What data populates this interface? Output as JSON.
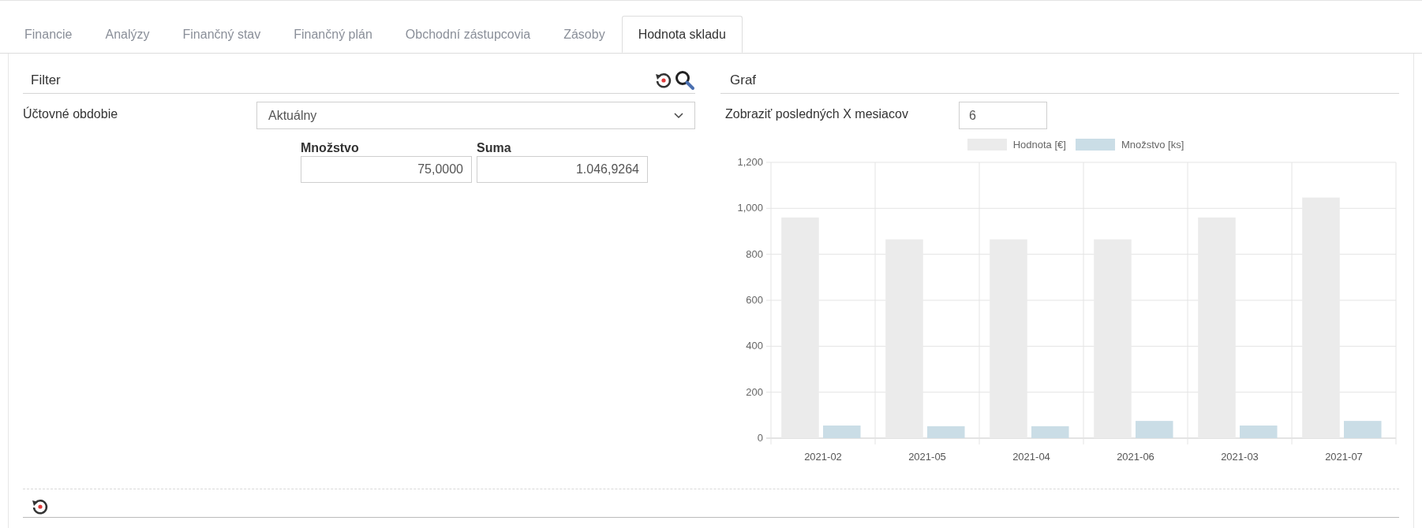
{
  "tabs": [
    {
      "label": "Financie",
      "selected": false
    },
    {
      "label": "Analýzy",
      "selected": false
    },
    {
      "label": "Finančný stav",
      "selected": false
    },
    {
      "label": "Finančný plán",
      "selected": false
    },
    {
      "label": "Obchodní zástupcovia",
      "selected": false
    },
    {
      "label": "Zásoby",
      "selected": false
    },
    {
      "label": "Hodnota skladu",
      "selected": true
    }
  ],
  "filter": {
    "title": "Filter",
    "period_label": "Účtovné obdobie",
    "period_value": "Aktuálny",
    "columns": [
      {
        "label": "Množstvo",
        "value": "75,0000"
      },
      {
        "label": "Suma",
        "value": "1.046,9264"
      }
    ]
  },
  "graph": {
    "title": "Graf",
    "months_label": "Zobraziť posledných X mesiacov",
    "months_value": "6",
    "chart_data": {
      "type": "bar",
      "categories": [
        "2021-02",
        "2021-05",
        "2021-04",
        "2021-06",
        "2021-03",
        "2021-07"
      ],
      "series": [
        {
          "name": "Hodnota [€]",
          "color": "#ebebeb",
          "values": [
            960,
            865,
            865,
            865,
            960,
            1047
          ]
        },
        {
          "name": "Množstvo [ks]",
          "color": "#cadde6",
          "values": [
            55,
            52,
            52,
            75,
            55,
            75
          ]
        }
      ],
      "grid": true,
      "legend": true,
      "ylim": [
        0,
        1200
      ],
      "yticks": [
        {
          "value": 0,
          "label": "0"
        },
        {
          "value": 200,
          "label": "200"
        },
        {
          "value": 400,
          "label": "400"
        },
        {
          "value": 600,
          "label": "600"
        },
        {
          "value": 800,
          "label": "800"
        },
        {
          "value": 1000,
          "label": "1,000"
        },
        {
          "value": 1200,
          "label": "1,200"
        }
      ]
    }
  }
}
